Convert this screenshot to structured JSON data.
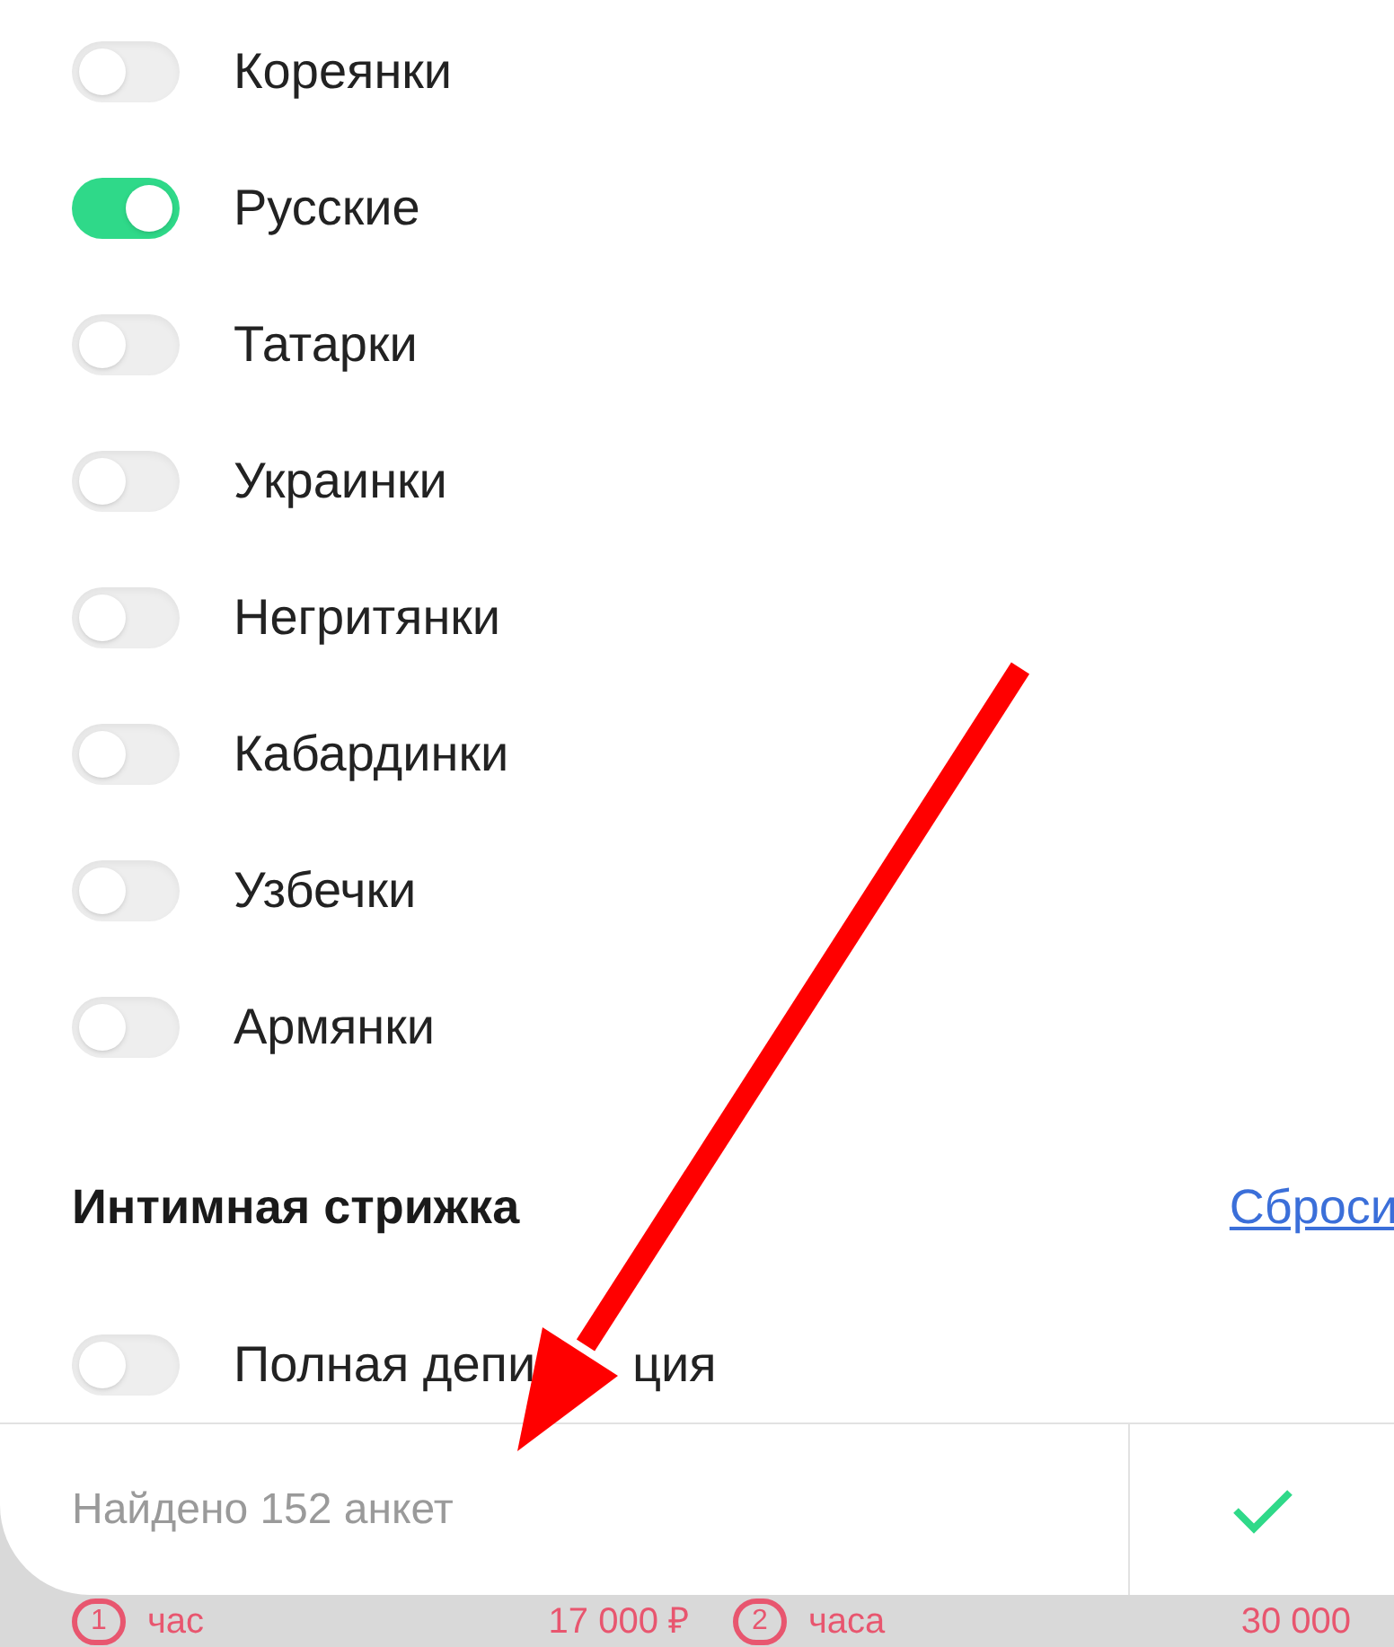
{
  "toggles": [
    {
      "label": "Кореянки",
      "on": false
    },
    {
      "label": "Русские",
      "on": true
    },
    {
      "label": "Татарки",
      "on": false
    },
    {
      "label": "Украинки",
      "on": false
    },
    {
      "label": "Негритянки",
      "on": false
    },
    {
      "label": "Кабардинки",
      "on": false
    },
    {
      "label": "Узбечки",
      "on": false
    },
    {
      "label": "Армянки",
      "on": false
    }
  ],
  "section": {
    "title": "Интимная стрижка",
    "reset_link": "Сброси",
    "toggles": [
      {
        "label": "Полная депи",
        "label_after_arrow": "ция",
        "on": false
      }
    ]
  },
  "footer": {
    "found_text": "Найдено 152 анкет"
  },
  "prices": [
    {
      "hours": "1",
      "unit": "час",
      "price": "17 000 ₽"
    },
    {
      "hours": "2",
      "unit": "часа",
      "price": "30 000"
    }
  ]
}
